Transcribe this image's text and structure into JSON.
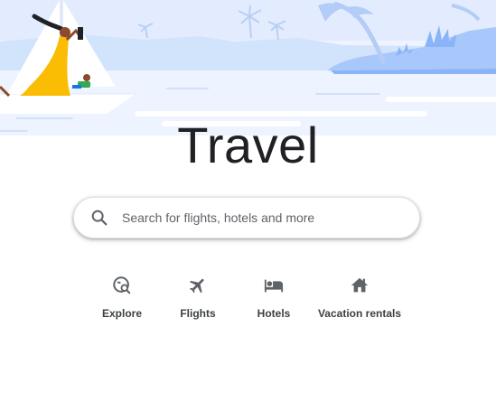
{
  "page": {
    "title": "Travel"
  },
  "search": {
    "placeholder": "Search for flights, hotels and more"
  },
  "nav": {
    "items": [
      {
        "label": "Explore",
        "icon": "explore-icon"
      },
      {
        "label": "Flights",
        "icon": "airplane-icon"
      },
      {
        "label": "Hotels",
        "icon": "bed-icon"
      },
      {
        "label": "Vacation rentals",
        "icon": "house-icon"
      }
    ]
  },
  "colors": {
    "sky": "#e8efff",
    "shore": "#aecbfa",
    "water": "#c6dafc",
    "text": "#202124",
    "icon": "#5f6368"
  }
}
